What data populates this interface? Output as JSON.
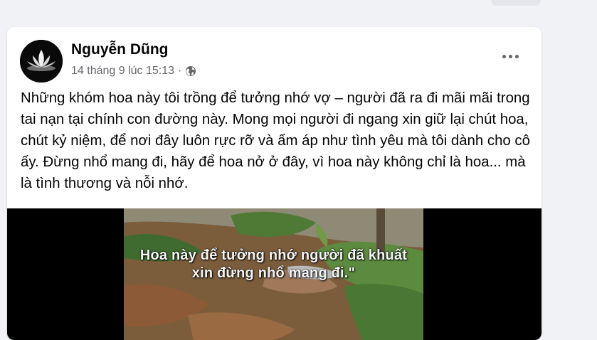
{
  "post": {
    "author": "Nguyễn Dũng",
    "timestamp": "14 tháng 9 lúc 15:13",
    "separator": "·",
    "privacy_icon": "globe-icon",
    "more_icon": "more-options-icon",
    "caption": "Những khóm hoa này tôi trồng để tưởng nhớ vợ – người đã ra đi mãi mãi trong tai nạn tại chính con đường này. Mong mọi người đi ngang xin giữ lại chút hoa, chút kỷ niệm, để nơi đây luôn rực rỡ và ấm áp như tình yêu mà tôi dành cho cô ấy. Đừng nhổ mang đi, hãy để hoa nở ở đây, vì hoa này không chỉ là hoa... mà là tình thương và nỗi nhớ.",
    "video": {
      "overlay_line1": "Hoa này để tưởng nhớ người đã khuất",
      "overlay_line2": "xin đừng nhổ mang đi.\""
    }
  },
  "colors": {
    "page_bg": "#f0f2f5",
    "card_bg": "#ffffff",
    "text_primary": "#050505",
    "text_secondary": "#65676b"
  }
}
